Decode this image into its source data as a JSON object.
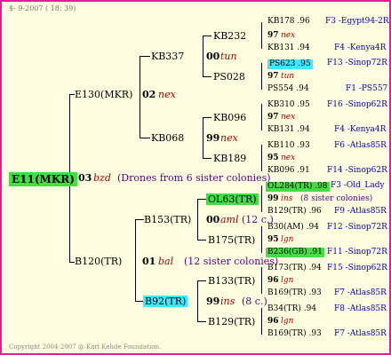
{
  "header": {
    "text": "$- 9-2007 ( 18: 39)"
  },
  "footer": {
    "text": "Copyright 2004-2007 @ Karl Kehde Foundation."
  },
  "root": {
    "label": "E11(MKR)",
    "num": "03",
    "code": "bzd",
    "note": "(Drones from 6 sister colonies)"
  },
  "p1": {
    "label": "E130(MKR)",
    "num": "02",
    "code": "nex"
  },
  "p2": {
    "label": "B120(TR)",
    "num": "01",
    "code": "bal",
    "note": "(12 sister colonies)"
  },
  "g1": {
    "label": "KB337",
    "num": "00",
    "code": "tun"
  },
  "g2": {
    "label": "KB068",
    "num": "99",
    "code": "nex"
  },
  "g3": {
    "label": "B153(TR)",
    "num": "00",
    "code": "aml",
    "note": "(12 c.)"
  },
  "g4": {
    "label": "B92(TR)",
    "num": "99",
    "code": "ins",
    "note": "(8 c.)"
  },
  "gg": [
    {
      "label": "KB232",
      "num": "97",
      "code": "nex"
    },
    {
      "label": "PS028",
      "num": "97",
      "code": "tun"
    },
    {
      "label": "KB096",
      "num": "97",
      "code": "nex"
    },
    {
      "label": "KB189",
      "num": "95",
      "code": "nex"
    },
    {
      "label": "OL63(TR)",
      "num": "99",
      "code": "ins",
      "note": "(8 sister colonies)"
    },
    {
      "label": "B175(TR)",
      "num": "95",
      "code": "lgn"
    },
    {
      "label": "B133(TR)",
      "num": "96",
      "code": "lgn"
    },
    {
      "label": "B129(TR)",
      "num": "96",
      "code": "lgn"
    }
  ],
  "ggg": [
    {
      "name": "KB178 .96",
      "link": "F3 -Egypt94-2R"
    },
    {
      "name": "KB131 .94",
      "link": "F4 -Kenya4R"
    },
    {
      "name": "PS623 .95",
      "link": "F13 -Sinop72R"
    },
    {
      "name": "PS554 .94",
      "link": "F1 -PS557"
    },
    {
      "name": "KB310 .95",
      "link": "F16 -Sinop62R"
    },
    {
      "name": "KB131 .94",
      "link": "F4 -Kenya4R"
    },
    {
      "name": "KB110 .93",
      "link": "F6 -Atlas85R"
    },
    {
      "name": "KB096 .91",
      "link": "F14 -Sinop62R"
    },
    {
      "name": "OL284(TR) .98",
      "link": "F3 -Old_Lady"
    },
    {
      "name": "B129(TR) .96",
      "link": "F9 -Atlas85R"
    },
    {
      "name": "B30(AM) .94",
      "link": "F12 -Sinop72R"
    },
    {
      "name": "B236(GB) .91",
      "link": "F11 -Sinop72R"
    },
    {
      "name": "B173(TR) .94",
      "link": "F15 -Sinop62R"
    },
    {
      "name": "B169(TR) .93",
      "link": "F7 -Atlas85R"
    },
    {
      "name": "B34(TR) .94",
      "link": "F8 -Atlas85R"
    },
    {
      "name": "B169(TR) .93",
      "link": "F7 -Atlas85R"
    }
  ]
}
